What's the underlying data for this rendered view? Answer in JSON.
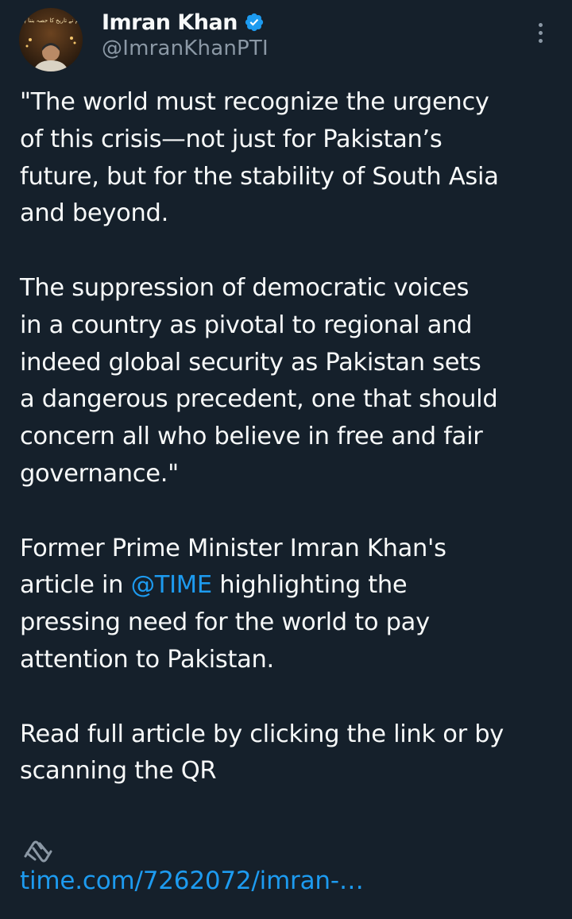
{
  "tweet": {
    "author": {
      "display_name": "Imran Khan",
      "handle": "@ImranKhanPTI",
      "verified": true,
      "avatar_text": "ہم نے تاریخ کا حصہ بننا ہے"
    },
    "paragraphs": [
      "\"The world must recognize the urgency\nof this crisis—not just for Pakistan’s\nfuture, but for the stability of South Asia\nand beyond.",
      "The suppression of democratic voices\nin a country as pivotal to regional and\nindeed global security as Pakistan sets\na dangerous precedent, one that should\nconcern all who believe in free and fair\ngovernance.\""
    ],
    "paragraph3": {
      "before": "Former Prime Minister Imran Khan's\narticle in ",
      "mention": "@TIME",
      "after": " highlighting the\npressing need for the world to pay\nattention to Pakistan."
    },
    "paragraph4": "Read full article by clicking the link or by\nscanning the QR",
    "link": {
      "icon": "link-icon",
      "url_text": "time.com/7262072/imran-…"
    }
  },
  "colors": {
    "background": "#15202b",
    "text": "#f7f9f9",
    "secondary": "#8b98a5",
    "accent": "#1d9bf0"
  },
  "icons": {
    "verified": "verified-badge-icon",
    "more": "more-options-icon"
  }
}
